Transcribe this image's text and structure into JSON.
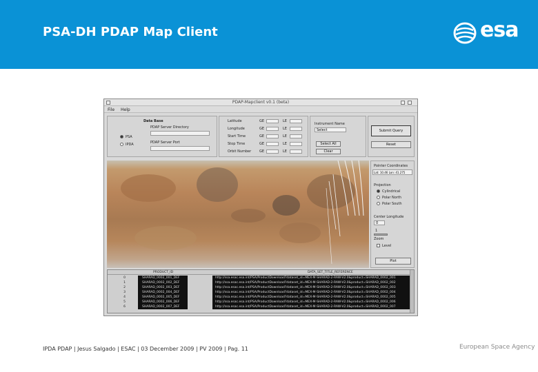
{
  "slide": {
    "title": "PSA-DH PDAP Map Client",
    "logo_text": "esa",
    "footer": "IPDA PDAP | Jesus Salgado | ESAC | 03 December 2009 | PV 2009 | Pag. 11",
    "agency": "European Space Agency",
    "colors": {
      "header": "#0a92d6",
      "text": "#ffffff"
    }
  },
  "app": {
    "window_title": "PDAP-Mapclient v0.1 (beta)",
    "menu": {
      "file": "File",
      "help": "Help"
    },
    "data_base": {
      "label": "Data Base",
      "server_dir_label": "PDAP Server Directory",
      "server_port_label": "PDAP Server Port",
      "opt_psa": "PSA",
      "opt_ipda": "IPDA"
    },
    "query": {
      "rows": [
        {
          "label": "Latitude",
          "op": "LE"
        },
        {
          "label": "Longitude",
          "op": "LE"
        },
        {
          "label": "Start Time",
          "op": "LE"
        },
        {
          "label": "Stop Time",
          "op": "LE"
        },
        {
          "label": "Orbit Number",
          "op": "LE"
        }
      ]
    },
    "instrument": {
      "label": "Instrument Name",
      "value": "Select",
      "select_all": "Select All",
      "clear": "Clear"
    },
    "buttons": {
      "submit": "Submit Query",
      "reset": "Reset",
      "plot": "Plot"
    },
    "side": {
      "pointer_label": "Pointer Coordinates",
      "pointer_value": "Lat: 10.46   Lon: 41.275",
      "projection_label": "Projection",
      "projection_options": [
        "Cylindrical",
        "Polar North",
        "Polar South"
      ],
      "center_label": "Center Longitude",
      "center_value": "0",
      "zoom_label": "Zoom",
      "zoom_value": "1",
      "level_label": "Level"
    },
    "table": {
      "columns": [
        "PRODUCT_ID",
        "DATA_SET_TITLE_REFERENCE"
      ],
      "rows": [
        {
          "n": "0",
          "id": "SHARAD_0002_001_DEF",
          "ref": "http://ssa.esac.esa.int/PSA/ProductDownload?dataset_id=MEX-M-SHARAD-2-RAW-V2.0&product=SHARAD_0002_001"
        },
        {
          "n": "1",
          "id": "SHARAD_0002_002_DEF",
          "ref": "http://ssa.esac.esa.int/PSA/ProductDownload?dataset_id=MEX-M-SHARAD-2-RAW-V2.0&product=SHARAD_0002_002"
        },
        {
          "n": "2",
          "id": "SHARAD_0002_003_DEF",
          "ref": "http://ssa.esac.esa.int/PSA/ProductDownload?dataset_id=MEX-M-SHARAD-2-RAW-V2.0&product=SHARAD_0002_003"
        },
        {
          "n": "3",
          "id": "SHARAD_0002_004_DEF",
          "ref": "http://ssa.esac.esa.int/PSA/ProductDownload?dataset_id=MEX-M-SHARAD-2-RAW-V2.0&product=SHARAD_0002_004"
        },
        {
          "n": "4",
          "id": "SHARAD_0002_005_DEF",
          "ref": "http://ssa.esac.esa.int/PSA/ProductDownload?dataset_id=MEX-M-SHARAD-2-RAW-V2.0&product=SHARAD_0002_005"
        },
        {
          "n": "5",
          "id": "SHARAD_0002_006_DEF",
          "ref": "http://ssa.esac.esa.int/PSA/ProductDownload?dataset_id=MEX-M-SHARAD-2-RAW-V2.0&product=SHARAD_0002_006"
        },
        {
          "n": "6",
          "id": "SHARAD_0002_007_DEF",
          "ref": "http://ssa.esac.esa.int/PSA/ProductDownload?dataset_id=MEX-M-SHARAD-2-RAW-V2.0&product=SHARAD_0002_007"
        }
      ]
    }
  }
}
